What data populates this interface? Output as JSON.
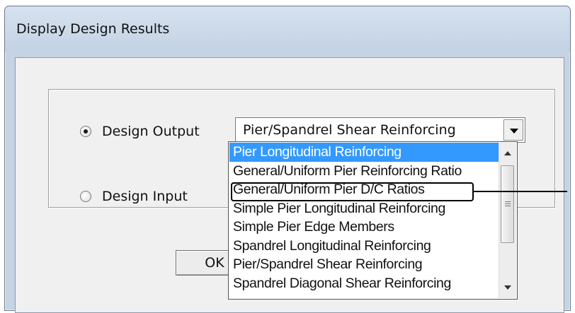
{
  "window": {
    "title": "Display Design Results"
  },
  "options": {
    "design_output": {
      "label": "Design Output",
      "checked": true
    },
    "design_input": {
      "label": "Design Input",
      "checked": false
    }
  },
  "combo": {
    "selected_value": "Pier/Spandrel Shear Reinforcing",
    "dropdown_icon": "chevron-down-icon"
  },
  "ok_button": {
    "label": "OK"
  },
  "dropdown_list": {
    "items": [
      "Pier Longitudinal Reinforcing",
      "General/Uniform Pier Reinforcing Ratio",
      "General/Uniform Pier D/C Ratios",
      "Simple Pier Longitudinal Reinforcing",
      "Simple Pier Edge Members",
      "Spandrel Longitudinal Reinforcing",
      "Pier/Spandrel Shear Reinforcing",
      "Spandrel Diagonal Shear Reinforcing"
    ],
    "highlighted_index": 0,
    "annotated_index": 2
  },
  "colors": {
    "selection": "#3399ff",
    "annotation": "#000000",
    "title_bar": "#c5d3e3"
  }
}
